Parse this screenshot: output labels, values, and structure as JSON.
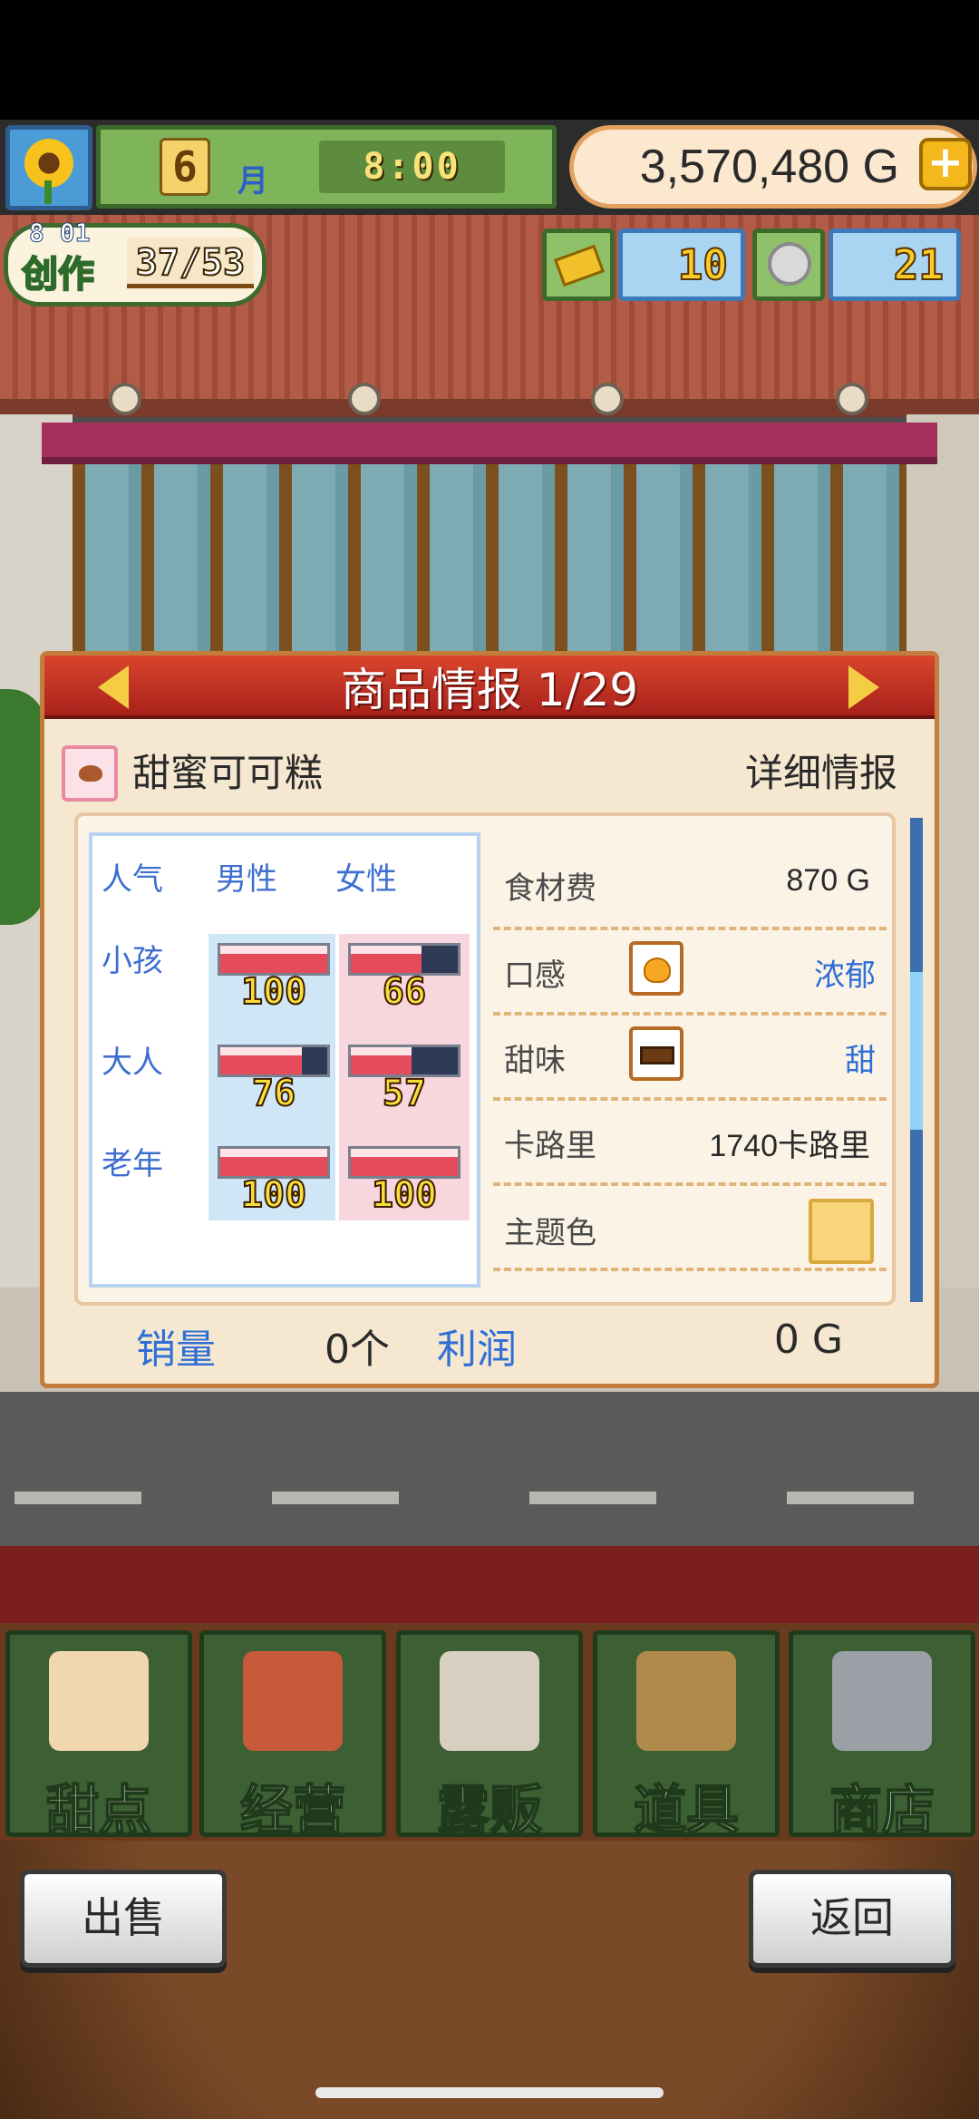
{
  "hud": {
    "month": "6",
    "month_label": "月",
    "time": "8:00",
    "money": "3,570,480",
    "money_unit": "G",
    "plus_icon": "plus-icon",
    "flower_icon": "sunflower-icon"
  },
  "creation": {
    "timer": "8 01",
    "label": "创作",
    "count": "37/53"
  },
  "resources": {
    "tickets": "10",
    "coins": "21",
    "ticket_icon": "gold-ticket-icon",
    "coin_icon": "silver-coin-icon"
  },
  "panel": {
    "title": "商品情报 1/29",
    "product_name": "甜蜜可可糕",
    "detail_link": "详细情报",
    "popularity": {
      "header": "人气",
      "male": "男性",
      "female": "女性",
      "rows": [
        {
          "label": "小孩",
          "male": "100",
          "female": "66"
        },
        {
          "label": "大人",
          "male": "76",
          "female": "57"
        },
        {
          "label": "老年",
          "male": "100",
          "female": "100"
        }
      ]
    },
    "info": {
      "cost_label": "食材费",
      "cost_value": "870 G",
      "texture_label": "口感",
      "texture_value": "浓郁",
      "sweet_label": "甜味",
      "sweet_value": "甜",
      "calorie_label": "卡路里",
      "calorie_value": "1740卡路里",
      "color_label": "主题色",
      "theme_color": "#f8d47a"
    },
    "sales_label": "销量",
    "sales_value": "0个",
    "profit_label": "利润",
    "profit_value": "0 G"
  },
  "nav": {
    "items": [
      {
        "label": "甜点",
        "icon": "cake-icon"
      },
      {
        "label": "经营",
        "icon": "shop-building-icon"
      },
      {
        "label": "露贩",
        "icon": "food-truck-icon"
      },
      {
        "label": "道具",
        "icon": "gear-bag-icon"
      },
      {
        "label": "商店",
        "icon": "shopping-cart-icon"
      }
    ]
  },
  "actions": {
    "sell": "出售",
    "back": "返回"
  },
  "colors": {
    "header_red": "#c0321f",
    "label_blue": "#2f6fd6",
    "nav_green": "#3d5f34"
  }
}
